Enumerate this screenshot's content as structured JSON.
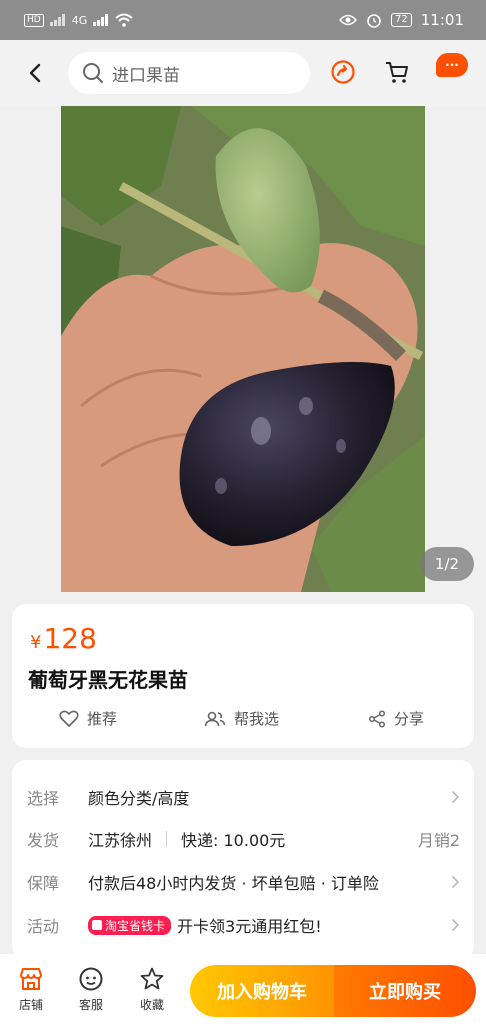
{
  "status_bar": {
    "network": "HD",
    "signal": "4G",
    "battery": "72",
    "time": "11:01"
  },
  "header": {
    "search_placeholder": "进口果苗"
  },
  "gallery": {
    "counter": "1/2"
  },
  "product": {
    "currency": "¥",
    "price": "128",
    "title": "葡萄牙黑无花果苗",
    "actions": [
      {
        "label": "推荐",
        "icon": "heart-icon"
      },
      {
        "label": "帮我选",
        "icon": "people-icon"
      },
      {
        "label": "分享",
        "icon": "share-icon"
      }
    ]
  },
  "info": {
    "select": {
      "label": "选择",
      "value": "颜色分类/高度"
    },
    "shipping": {
      "label": "发货",
      "location": "江苏徐州",
      "express": "快递: 10.00元",
      "monthly_sales": "月销2"
    },
    "guarantee": {
      "label": "保障",
      "value": "付款后48小时内发货 · 坏单包赔 · 订单险"
    },
    "promo": {
      "label": "活动",
      "badge": "淘宝省钱卡",
      "value": "开卡领3元通用红包!"
    }
  },
  "bottom": {
    "shop": "店铺",
    "service": "客服",
    "favorite": "收藏",
    "add_to_cart": "加入购物车",
    "buy_now": "立即购买"
  },
  "colors": {
    "accent": "#ff5000",
    "cart_gradient_start": "#ffc700",
    "buy_gradient_end": "#ff4f00"
  }
}
